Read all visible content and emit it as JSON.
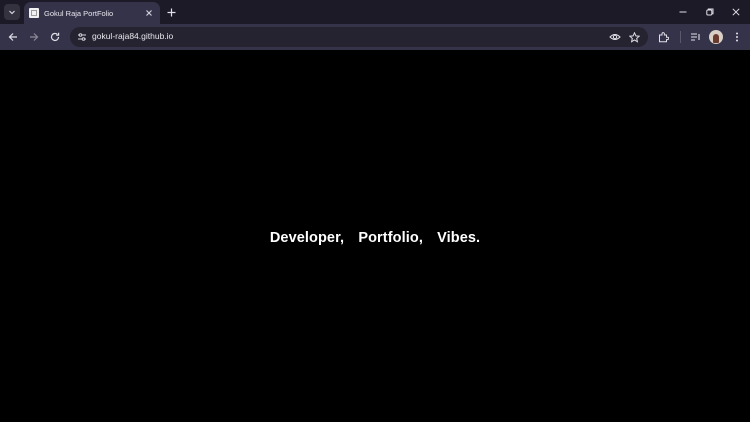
{
  "browser": {
    "tab": {
      "title": "Gokul Raja PortFolio",
      "favicon": "page-favicon"
    },
    "address_bar": {
      "url": "gokul-raja84.github.io"
    },
    "colors": {
      "titlebar": "#1b1a26",
      "toolbar": "#35334a",
      "omnibox": "#24232f"
    }
  },
  "page": {
    "background": "#000000",
    "headline_words": [
      "Developer,",
      "Portfolio,",
      "Vibes."
    ]
  }
}
